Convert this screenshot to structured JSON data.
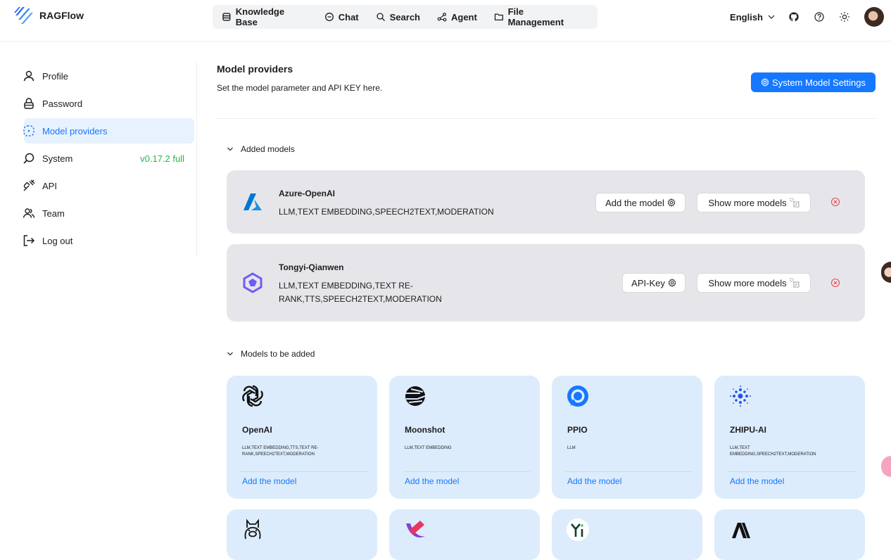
{
  "app": {
    "name": "RAGFlow"
  },
  "nav": [
    {
      "label": "Knowledge Base",
      "icon": "database-icon"
    },
    {
      "label": "Chat",
      "icon": "chat-bubble-icon"
    },
    {
      "label": "Search",
      "icon": "search-icon"
    },
    {
      "label": "Agent",
      "icon": "agent-graph-icon"
    },
    {
      "label": "File Management",
      "icon": "folder-icon"
    }
  ],
  "header": {
    "language": "English"
  },
  "sidebar": {
    "items": [
      {
        "label": "Profile",
        "icon": "user-icon"
      },
      {
        "label": "Password",
        "icon": "lock-icon"
      },
      {
        "label": "Model providers",
        "icon": "model-providers-icon",
        "active": true
      },
      {
        "label": "System",
        "icon": "system-icon",
        "badge": "v0.17.2 full"
      },
      {
        "label": "API",
        "icon": "api-plug-icon"
      },
      {
        "label": "Team",
        "icon": "team-icon"
      },
      {
        "label": "Log out",
        "icon": "logout-icon"
      }
    ]
  },
  "main": {
    "title": "Model providers",
    "subtitle": "Set the model parameter and API KEY here.",
    "system_button": "System Model Settings",
    "added_section": "Added models",
    "to_add_section": "Models to be added",
    "added_models": [
      {
        "name": "Azure-OpenAI",
        "tags": "LLM,TEXT EMBEDDING,SPEECH2TEXT,MODERATION",
        "primary_button": "Add the model",
        "more_button": "Show more models",
        "logo": "azure-logo-icon"
      },
      {
        "name": "Tongyi-Qianwen",
        "tags_line1": "LLM,TEXT EMBEDDING,TEXT RE-",
        "tags_line2": "RANK,TTS,SPEECH2TEXT,MODERATION",
        "primary_button": "API-Key",
        "more_button": "Show more models",
        "logo": "tongyi-logo-icon"
      }
    ],
    "models_to_add": [
      {
        "name": "OpenAI",
        "tags_line1": "LLM,TEXT EMBEDDING,TTS,TEXT RE-",
        "tags_line2": "RANK,SPEECH2TEXT,MODERATION",
        "action": "Add the model",
        "logo": "openai-logo-icon"
      },
      {
        "name": "Moonshot",
        "tags_line1": "LLM,TEXT EMBEDDING",
        "tags_line2": "",
        "action": "Add the model",
        "logo": "moonshot-logo-icon"
      },
      {
        "name": "PPIO",
        "tags_line1": "LLM",
        "tags_line2": "",
        "action": "Add the model",
        "logo": "ppio-logo-icon"
      },
      {
        "name": "ZHIPU-AI",
        "tags_line1": "LLM,TEXT",
        "tags_line2": "EMBEDDING,SPEECH2TEXT,MODERATION",
        "action": "Add the model",
        "logo": "zhipu-logo-icon"
      }
    ],
    "more_row_logos": [
      "ollama-logo-icon",
      "xinference-logo-icon",
      "yi-logo-icon",
      "anthropic-logo-icon"
    ]
  },
  "colors": {
    "accent": "#1677ff",
    "version": "#22b74a",
    "delete": "#e5484d",
    "added_card": "#e6e6ea",
    "grid_card": "#dcecfc",
    "active_item": "#e7f2fe"
  }
}
